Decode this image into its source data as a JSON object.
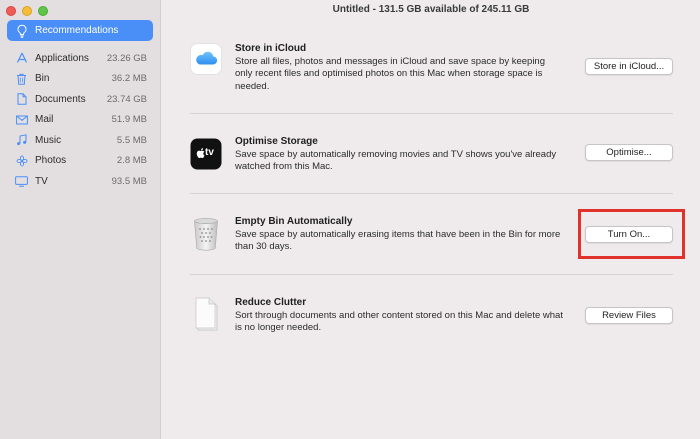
{
  "window": {
    "title": "Untitled - 131.5 GB available of 245.11 GB"
  },
  "sidebar": {
    "selected": {
      "label": "Recommendations",
      "icon": "lightbulb-icon"
    },
    "items": [
      {
        "label": "Applications",
        "size": "23.26 GB",
        "icon": "applications-icon"
      },
      {
        "label": "Bin",
        "size": "36.2 MB",
        "icon": "trash-icon"
      },
      {
        "label": "Documents",
        "size": "23.74 GB",
        "icon": "document-icon"
      },
      {
        "label": "Mail",
        "size": "51.9 MB",
        "icon": "mail-icon"
      },
      {
        "label": "Music",
        "size": "5.5 MB",
        "icon": "music-note-icon"
      },
      {
        "label": "Photos",
        "size": "2.8 MB",
        "icon": "photos-icon"
      },
      {
        "label": "TV",
        "size": "93.5 MB",
        "icon": "tv-icon"
      }
    ]
  },
  "recommendations": [
    {
      "title": "Store in iCloud",
      "description": "Store all files, photos and messages in iCloud and save space by keeping only recent files and optimised photos on this Mac when storage space is needed.",
      "button": "Store in iCloud...",
      "icon": "icloud-icon"
    },
    {
      "title": "Optimise Storage",
      "description": "Save space by automatically removing movies and TV shows you've already watched from this Mac.",
      "button": "Optimise...",
      "icon": "apple-tv-icon",
      "icon_text": "tv"
    },
    {
      "title": "Empty Bin Automatically",
      "description": "Save space by automatically erasing items that have been in the Bin for more than 30 days.",
      "button": "Turn On...",
      "icon": "bin-icon"
    },
    {
      "title": "Reduce Clutter",
      "description": "Sort through documents and other content stored on this Mac and delete what is no longer needed.",
      "button": "Review Files",
      "icon": "document-stack-icon"
    }
  ],
  "colors": {
    "accent": "#4a8ff7",
    "highlight": "#e0322a"
  }
}
